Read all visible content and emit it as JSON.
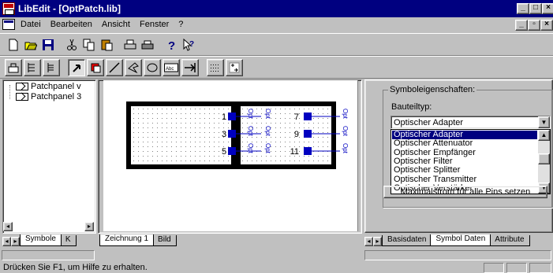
{
  "window": {
    "title": "LibEdit - [OptPatch.lib]"
  },
  "menu": {
    "items": [
      "Datei",
      "Bearbeiten",
      "Ansicht",
      "Fenster",
      "?"
    ]
  },
  "tree": {
    "items": [
      "Patchpanel v",
      "Patchpanel 3"
    ]
  },
  "left_tabs": [
    "Symbole",
    "K"
  ],
  "canvas_tabs": [
    "Zeichnung 1",
    "Bild"
  ],
  "right_tabs": [
    "Basisdaten",
    "Symbol Daten",
    "Attribute"
  ],
  "canvas": {
    "pin_numbers": [
      "1",
      "3",
      "5",
      "7",
      "9",
      "11"
    ],
    "pin_label": "Opt"
  },
  "props": {
    "group_title": "Symboleigenschaften:",
    "type_label": "Bauteiltyp:",
    "selected": "Optischer Adapter",
    "options": [
      "Optischer Adapter",
      "Optischer Attenuator",
      "Optischer Empfänger",
      "Optischer Filter",
      "Optischer Splitter",
      "Optischer Transmitter",
      "Optischer Verstärker"
    ],
    "highlighted_index": 0,
    "max_button": "Maximalstrom für alle Pins setzen"
  },
  "status": {
    "text": "Drücken Sie F1, um Hilfe zu erhalten."
  },
  "colors": {
    "titlebar": "#000080",
    "face": "#c0c0c0",
    "selection": "#000080",
    "pin_blue": "#0000c0"
  }
}
